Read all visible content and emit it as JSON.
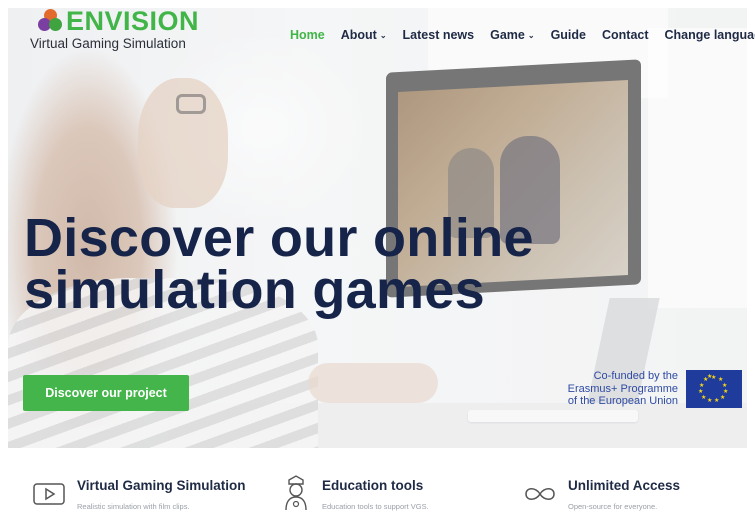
{
  "header": {
    "logo_word": "ENVISION",
    "logo_sub": "Virtual Gaming Simulation",
    "brand_color": "#42b549",
    "nav": [
      {
        "label": "Home",
        "active": true,
        "dropdown": false
      },
      {
        "label": "About",
        "active": false,
        "dropdown": true
      },
      {
        "label": "Latest news",
        "active": false,
        "dropdown": false
      },
      {
        "label": "Game",
        "active": false,
        "dropdown": true
      },
      {
        "label": "Guide",
        "active": false,
        "dropdown": false
      },
      {
        "label": "Contact",
        "active": false,
        "dropdown": false
      },
      {
        "label": "Change language",
        "active": false,
        "dropdown": false
      }
    ]
  },
  "hero": {
    "headline_line1": "Discover our online",
    "headline_line2": "simulation games",
    "cta_label": "Discover our project",
    "cta_color": "#43b54a",
    "eu_line1": "Co-funded by the",
    "eu_line2": "Erasmus+ Programme",
    "eu_line3": "of the European Union"
  },
  "features": [
    {
      "icon": "play-icon",
      "title": "Virtual Gaming Simulation",
      "desc": "Realistic simulation with film clips."
    },
    {
      "icon": "nurse-icon",
      "title": "Education tools",
      "desc": "Education tools to support VGS."
    },
    {
      "icon": "infinity-icon",
      "title": "Unlimited Access",
      "desc": "Open-source for everyone."
    }
  ]
}
